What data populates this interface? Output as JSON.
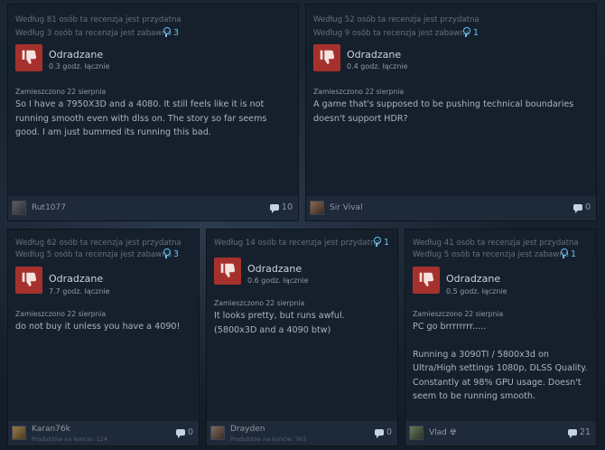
{
  "reviews": [
    {
      "helpful": "Według 81 osób ta recenzja jest przydatna",
      "funny": "Według 3 osób ta recenzja jest zabawna",
      "awards": "3",
      "verdict": "Odradzane",
      "hours": "0.3 godz. łącznie",
      "posted": "Zamieszczono 22 sierpnia",
      "text": [
        "So I have a 7950X3D and a 4080. It still feels like it is not running smooth even with dlss on. The story so far seems good. I am just bummed its running this bad."
      ],
      "username": "Rut1077",
      "products": "",
      "comments": "10"
    },
    {
      "helpful": "Według 52 osób ta recenzja jest przydatna",
      "funny": "Według 9 osób ta recenzja jest zabawna",
      "awards": "1",
      "verdict": "Odradzane",
      "hours": "0.4 godz. łącznie",
      "posted": "Zamieszczono 22 sierpnia",
      "text": [
        "A game that's supposed to be pushing technical boundaries doesn't support HDR?"
      ],
      "username": "Sir Vival",
      "products": "",
      "comments": "0"
    },
    {
      "helpful": "Według 62 osób ta recenzja jest przydatna",
      "funny": "Według 5 osób ta recenzja jest zabawna",
      "awards": "3",
      "verdict": "Odradzane",
      "hours": "7.7 godz. łącznie",
      "posted": "Zamieszczono 22 sierpnia",
      "text": [
        "do not buy it unless you have a 4090!"
      ],
      "username": "Karan76k",
      "products": "Produktów na koncie: 124",
      "comments": "0"
    },
    {
      "helpful": "Według 14 osób ta recenzja jest przydatna",
      "funny": "",
      "awards": "1",
      "verdict": "Odradzane",
      "hours": "0.6 godz. łącznie",
      "posted": "Zamieszczono 22 sierpnia",
      "text": [
        "It looks pretty, but runs awful. (5800x3D and a 4090 btw)"
      ],
      "username": "Drayden",
      "products": "Produktów na koncie: 763",
      "comments": "0"
    },
    {
      "helpful": "Według 41 osób ta recenzja jest przydatna",
      "funny": "Według 5 osób ta recenzja jest zabawna",
      "awards": "1",
      "verdict": "Odradzane",
      "hours": "0.5 godz. łącznie",
      "posted": "Zamieszczono 22 sierpnia",
      "text": [
        "PC go brrrrrrrr.....",
        "Running a 3090TI / 5800x3d on Ultra/High settings 1080p, DLSS Quality. Constantly at 98% GPU usage. Doesn't seem to be running smooth."
      ],
      "username": "Vlad ☢",
      "products": "",
      "comments": "21"
    }
  ],
  "colors": {
    "thumb_down": "#a6312c",
    "award": "#66c0f4",
    "card_bg": "#16202d",
    "footer_bg": "#1e2a39"
  },
  "icons": {
    "thumb": "thumbs-down-icon",
    "award": "award-icon",
    "comment": "comment-icon"
  }
}
